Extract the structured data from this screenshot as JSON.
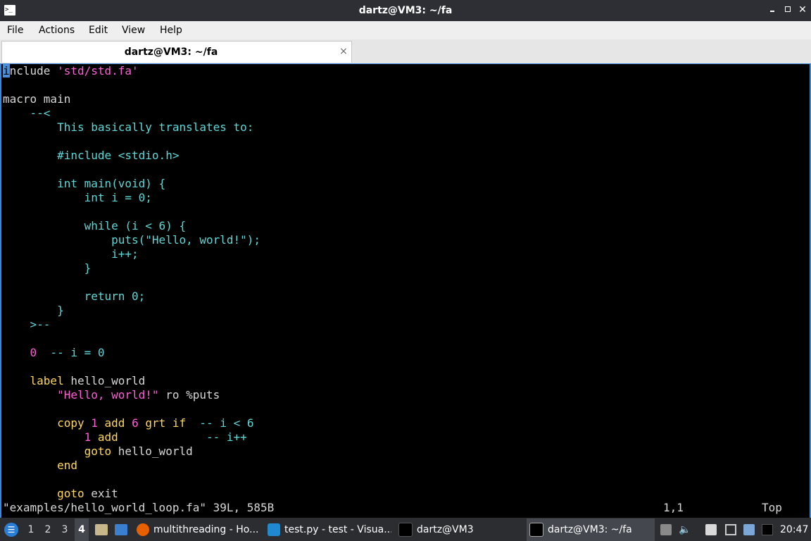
{
  "window": {
    "title": "dartz@VM3: ~/fa",
    "app_icon": "terminal-icon",
    "app_icon_glyph": ">_"
  },
  "menubar": {
    "items": [
      "File",
      "Actions",
      "Edit",
      "View",
      "Help"
    ]
  },
  "tab": {
    "label": "dartz@VM3: ~/fa",
    "close_glyph": "×"
  },
  "editor": {
    "lines": [
      [
        [
          "cursor",
          "i"
        ],
        [
          "c-plain",
          "nclude "
        ],
        [
          "c-str",
          "'std/std.fa'"
        ]
      ],
      [],
      [
        [
          "c-plain",
          "macro main"
        ]
      ],
      [
        [
          "c-plain",
          "    "
        ],
        [
          "c-cm",
          "--<"
        ]
      ],
      [
        [
          "c-cm",
          "        This basically translates to:"
        ]
      ],
      [],
      [
        [
          "c-cm",
          "        #include <stdio.h>"
        ]
      ],
      [],
      [
        [
          "c-cm",
          "        int main(void) {"
        ]
      ],
      [
        [
          "c-cm",
          "            int i = 0;"
        ]
      ],
      [],
      [
        [
          "c-cm",
          "            while (i < 6) {"
        ]
      ],
      [
        [
          "c-cm",
          "                puts(\"Hello, world!\");"
        ]
      ],
      [
        [
          "c-cm",
          "                i++;"
        ]
      ],
      [
        [
          "c-cm",
          "            }"
        ]
      ],
      [],
      [
        [
          "c-cm",
          "            return 0;"
        ]
      ],
      [
        [
          "c-cm",
          "        }"
        ]
      ],
      [
        [
          "c-cm",
          "    >--"
        ]
      ],
      [],
      [
        [
          "c-plain",
          "    "
        ],
        [
          "c-num",
          "0"
        ],
        [
          "c-cm",
          "  -- i = 0"
        ]
      ],
      [],
      [
        [
          "c-plain",
          "    "
        ],
        [
          "c-kw",
          "label"
        ],
        [
          "c-plain",
          " hello_world"
        ]
      ],
      [
        [
          "c-plain",
          "        "
        ],
        [
          "c-str",
          "\"Hello, world!\""
        ],
        [
          "c-plain",
          " ro %puts"
        ]
      ],
      [],
      [
        [
          "c-plain",
          "        "
        ],
        [
          "c-kw",
          "copy"
        ],
        [
          "c-plain",
          " "
        ],
        [
          "c-num",
          "1"
        ],
        [
          "c-plain",
          " "
        ],
        [
          "c-kw",
          "add"
        ],
        [
          "c-plain",
          " "
        ],
        [
          "c-num",
          "6"
        ],
        [
          "c-plain",
          " "
        ],
        [
          "c-kw",
          "grt"
        ],
        [
          "c-plain",
          " "
        ],
        [
          "c-kw",
          "if"
        ],
        [
          "c-cm",
          "  -- i < 6"
        ]
      ],
      [
        [
          "c-plain",
          "            "
        ],
        [
          "c-num",
          "1"
        ],
        [
          "c-plain",
          " "
        ],
        [
          "c-kw",
          "add"
        ],
        [
          "c-cm",
          "             -- i++"
        ]
      ],
      [
        [
          "c-plain",
          "            "
        ],
        [
          "c-kw",
          "goto"
        ],
        [
          "c-plain",
          " hello_world"
        ]
      ],
      [
        [
          "c-plain",
          "        "
        ],
        [
          "c-kw",
          "end"
        ]
      ],
      [],
      [
        [
          "c-plain",
          "        "
        ],
        [
          "c-kw",
          "goto"
        ],
        [
          "c-plain",
          " exit"
        ]
      ]
    ],
    "status_file": "\"examples/hello_world_loop.fa\" 39L, 585B",
    "status_position": "1,1",
    "status_scroll": "Top"
  },
  "taskbar": {
    "start_icon": "menu-icon",
    "workspaces": [
      "1",
      "2",
      "3",
      "4"
    ],
    "active_workspace": "4",
    "launchers": [
      "file-manager-icon",
      "desktop-icon"
    ],
    "tasks": [
      {
        "label": "multithreading - Ho...",
        "icon": "firefox-icon",
        "color": "#e66000"
      },
      {
        "label": "test.py - test - Visua...",
        "icon": "vscode-icon",
        "color": "#1f8ad2"
      },
      {
        "label": "dartz@VM3",
        "icon": "terminal-icon",
        "color": "#000000"
      },
      {
        "label": "dartz@VM3: ~/fa",
        "icon": "terminal-icon",
        "color": "#000000",
        "active": true
      }
    ],
    "tray": [
      "upload-icon",
      "volume-icon",
      "clipboard-icon",
      "network-icon",
      "keyboard-icon",
      "screen-icon"
    ],
    "clock": "20:47"
  },
  "colors": {
    "accent": "#3a88d8",
    "string": "#ff5fd7",
    "keyword": "#ffd75f",
    "comment": "#5fd7d7"
  }
}
